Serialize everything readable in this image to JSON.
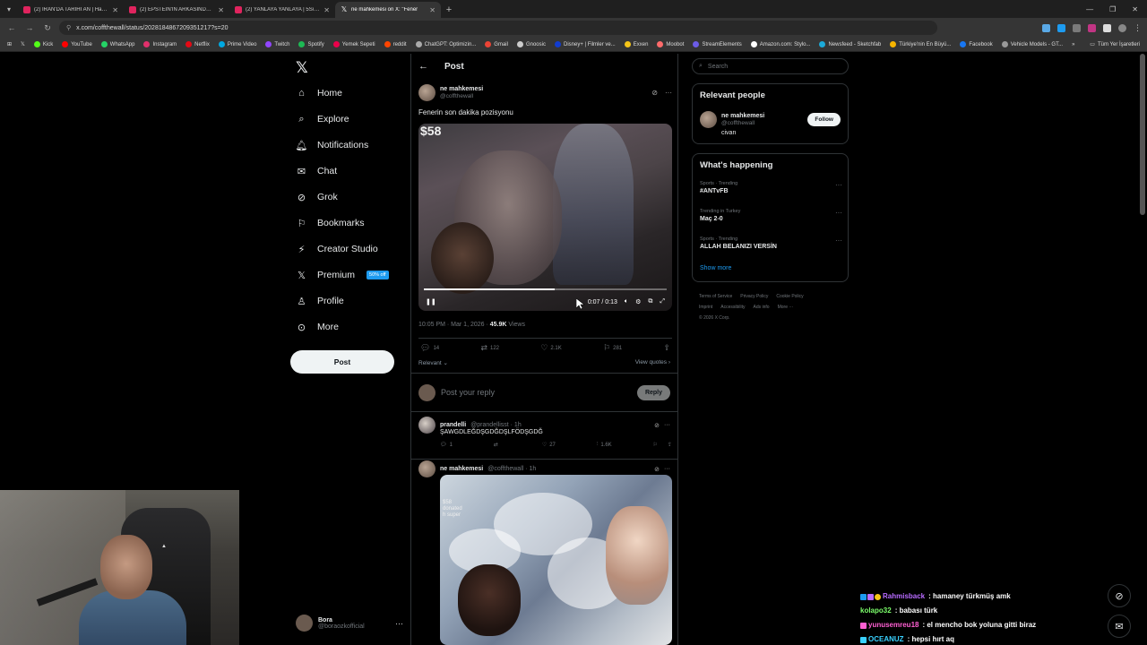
{
  "browser": {
    "tabs": [
      {
        "title": "(2) İRAN'DA TARİHİ AN | Hamaı",
        "active": false
      },
      {
        "title": "(2) EPSTEIN'İN ARKASINDAKİ G",
        "active": false
      },
      {
        "title": "(2) YANLAYA YANLAYA | 5Sıden",
        "active": false
      },
      {
        "title": "ne mahkemesi on X: \"Fener",
        "active": true
      }
    ],
    "url": "x.com/coffthewall/status/2028184867209351217?s=20",
    "bookmarks": [
      "Kick",
      "YouTube",
      "WhatsApp",
      "Instagram",
      "Netflix",
      "Prime Video",
      "Twitch",
      "Spotify",
      "Yemek Sepeti",
      "reddit",
      "ChatGPT: Optimizin...",
      "Gmail",
      "Gnoosic",
      "Disney+ | Filmler ve...",
      "Exxen",
      "Moobot",
      "StreamElements",
      "Amazon.com: Stylo...",
      "Newsfeed - Sketchfab",
      "Türkiye'nin En Büyü...",
      "Facebook",
      "Vehicle Models - GT..."
    ],
    "bookmarks_overflow": "»",
    "all_bookmarks": "Tüm Yer İşaretleri"
  },
  "nav": {
    "items": [
      {
        "label": "Home",
        "icon": "home-icon",
        "glyph": "⌂"
      },
      {
        "label": "Explore",
        "icon": "search-icon",
        "glyph": "⌕"
      },
      {
        "label": "Notifications",
        "icon": "bell-icon",
        "glyph": "♫"
      },
      {
        "label": "Chat",
        "icon": "mail-icon",
        "glyph": "✉"
      },
      {
        "label": "Grok",
        "icon": "grok-icon",
        "glyph": "⊘"
      },
      {
        "label": "Bookmarks",
        "icon": "bookmark-icon",
        "glyph": "⚑"
      },
      {
        "label": "Creator Studio",
        "icon": "creator-studio-icon",
        "glyph": "⚡"
      },
      {
        "label": "Premium",
        "icon": "x-premium-icon",
        "glyph": "𝕏"
      },
      {
        "label": "Profile",
        "icon": "profile-icon",
        "glyph": "⚇"
      },
      {
        "label": "More",
        "icon": "more-circle-icon",
        "glyph": "⋯"
      }
    ],
    "premium_badge": "50% off",
    "post_button": "Post",
    "account": {
      "name": "Bora",
      "handle": "@boraozkofficial"
    }
  },
  "main": {
    "header_title": "Post",
    "tweet": {
      "name": "ne mahkemesi",
      "handle": "@coffthewall",
      "text": "Fenerin son dakika pozisyonu",
      "video_overlay_number": "$58",
      "video_time": "0:07 / 0:13",
      "video_progress": 0.54,
      "timestamp": "10:05 PM · Mar 1, 2026 · ",
      "views_count": "45.9K",
      "views_label": " Views",
      "replies": "14",
      "reposts": "122",
      "likes": "2.1K",
      "bookmarks": "281"
    },
    "relevant_label": "Relevant",
    "view_quotes": "View quotes",
    "reply_placeholder": "Post your reply",
    "reply_button": "Reply",
    "replies": [
      {
        "name": "prandelli",
        "handle": "@prandellisst · 1h",
        "text": "ŞAWGDLEĞDŞGDĞDŞLFÖDŞGDĞ",
        "replies": "1",
        "reposts": "",
        "likes": "27",
        "views": "1.6K"
      },
      {
        "name": "ne mahkemesi",
        "handle": "@coffthewall · 1h",
        "image_text": "$58\ndonated\nh super"
      }
    ]
  },
  "sidebar": {
    "search_placeholder": "Search",
    "relevant_title": "Relevant people",
    "person": {
      "name": "ne mahkemesi",
      "handle": "@coffthewall",
      "bio": "civan",
      "follow": "Follow"
    },
    "happening_title": "What's happening",
    "trends": [
      {
        "category": "Sports · Trending",
        "name": "#ANTvFB"
      },
      {
        "category": "Trending in Turkey",
        "name": "Maç 2-0"
      },
      {
        "category": "Sports · Trending",
        "name": "ALLAH BELANIZI VERSİN"
      }
    ],
    "show_more": "Show more",
    "footer_links": [
      "Terms of Service",
      "Privacy Policy",
      "Cookie Policy",
      "Imprint",
      "Accessibility",
      "Ads info",
      "More ···"
    ],
    "copyright": "© 2026 X Corp."
  },
  "stream_chat": [
    {
      "user": "Rahmisback",
      "color": "#b86bff",
      "message": ": hamaney türkmüş amk"
    },
    {
      "user": "kolapo32",
      "color": "#7cff6b",
      "message": ": babası türk"
    },
    {
      "user": "yunusemreu18",
      "color": "#ff5fd2",
      "message": ": el mencho bok yoluna gitti biraz"
    },
    {
      "user": "OCEANUZ",
      "color": "#39d1ff",
      "message": ": hepsi hırt aq"
    }
  ],
  "colors": {
    "accent": "#1d9bf0",
    "background": "#000000",
    "border": "#2f3336",
    "muted": "#71767b"
  }
}
